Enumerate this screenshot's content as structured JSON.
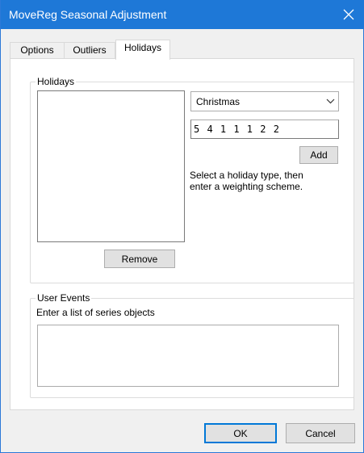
{
  "window": {
    "title": "MoveReg Seasonal Adjustment",
    "close_glyph": "✕"
  },
  "tabs": [
    {
      "label": "Options",
      "active": false
    },
    {
      "label": "Outliers",
      "active": false
    },
    {
      "label": "Holidays",
      "active": true
    }
  ],
  "holidays": {
    "group_label": "Holidays",
    "holiday_type": {
      "selected": "Christmas",
      "icon": "chevron-down-icon"
    },
    "weighting": {
      "value": "5 4 1 1 1 2 2"
    },
    "add_label": "Add",
    "hint": [
      "Select a holiday type, then",
      "enter a weighting scheme."
    ],
    "remove_label": "Remove"
  },
  "user_events": {
    "group_label": "User Events",
    "prompt": "Enter a list of series objects",
    "value": ""
  },
  "footer": {
    "ok_label": "OK",
    "cancel_label": "Cancel"
  },
  "colors": {
    "titlebar": "#1e78d7",
    "default_button_border": "#0078d7"
  }
}
